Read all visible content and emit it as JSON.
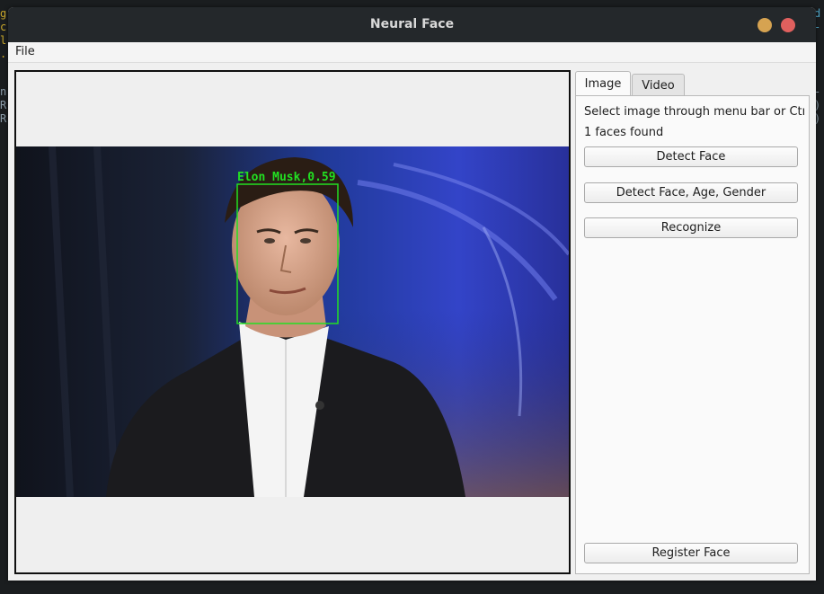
{
  "window": {
    "title": "Neural Face"
  },
  "menu": {
    "file": "File"
  },
  "tabs": [
    {
      "label": "Image"
    },
    {
      "label": "Video"
    }
  ],
  "image_tab": {
    "instruction": "Select image through menu bar or Ctrl-",
    "status": "1 faces found",
    "buttons": {
      "detect_face": "Detect Face",
      "detect_face_age_gender": "Detect Face, Age, Gender",
      "recognize": "Recognize",
      "register_face": "Register Face"
    }
  },
  "detection": {
    "label": "Elon Musk,0.59",
    "box_color": "#22e022"
  },
  "colors": {
    "titlebar": "#24282b",
    "minimize": "#d6a351",
    "close": "#e0605e",
    "panel_bg": "#f0f0f0"
  }
}
